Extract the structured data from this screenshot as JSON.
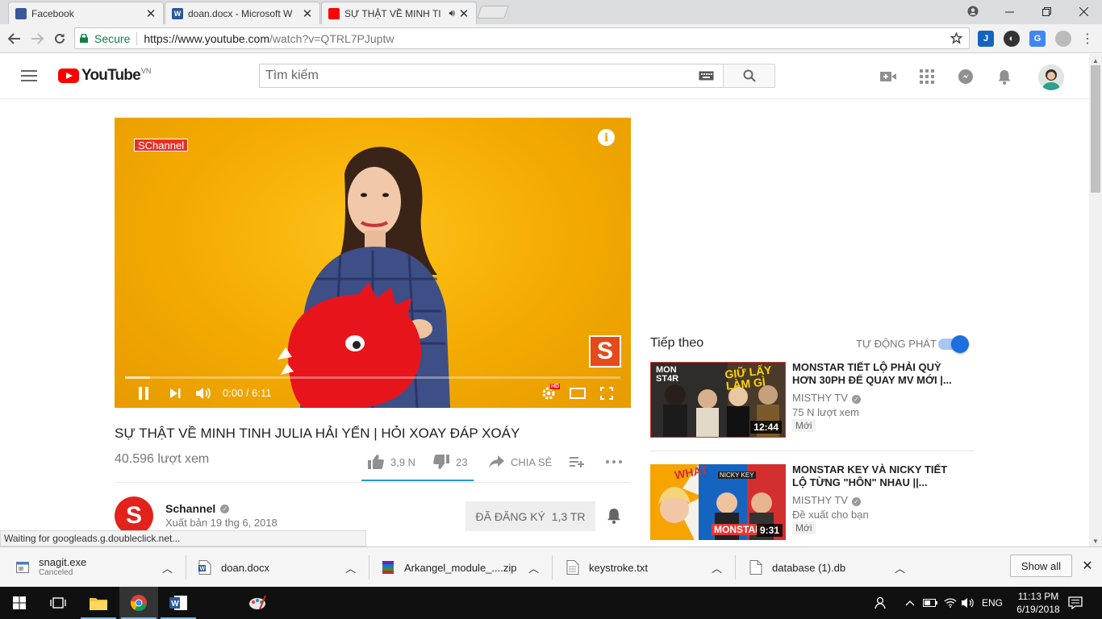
{
  "tabs": [
    {
      "title": "Facebook",
      "icon": "facebook-icon",
      "color": "#3b5998"
    },
    {
      "title": "doan.docx - Microsoft W",
      "icon": "word-icon",
      "color": "#2b579a"
    },
    {
      "title": "SỰ THẬT VỀ MINH TI",
      "icon": "youtube-icon",
      "color": "#ff0000",
      "audio": true
    }
  ],
  "address": {
    "secure_label": "Secure",
    "url_host": "https://www.youtube.com",
    "url_path": "/watch?v=QTRL7PJuptw"
  },
  "youtube": {
    "logo_text": "YouTube",
    "region": "VN",
    "search_placeholder": "Tìm kiếm"
  },
  "player": {
    "channel_watermark": "SChannel",
    "watermark_letter": "S",
    "time_current": "0:00",
    "time_total": "6:11",
    "time_display": "0:00 / 6:11",
    "progress_played": 0.0,
    "progress_buffered": 0.05,
    "hd_badge": "HD",
    "accent_color": "#ff0000"
  },
  "video": {
    "title": "SỰ THẬT VỀ MINH TINH JULIA HẢI YẾN | HỎI XOAY ĐÁP XOÁY",
    "views": "40.596 lượt xem",
    "likes": "3,9 N",
    "dislikes": "23",
    "share_label": "CHIA SẺ",
    "like_ratio": 0.994
  },
  "channel": {
    "name": "Schannel",
    "published": "Xuất bản 19 thg 6, 2018",
    "avatar_letter": "S",
    "subscribed_label": "ĐÃ ĐĂNG KÝ",
    "subscriber_count": "1,3 TR"
  },
  "sidebar": {
    "up_next_label": "Tiếp theo",
    "autoplay_label": "TỰ ĐỘNG PHÁT",
    "autoplay_on": true,
    "items": [
      {
        "title": "MONSTAR TIẾT LỘ PHẢI QUỲ HƠN 30PH ĐỂ QUAY MV MỚI |...",
        "channel": "MISTHY TV",
        "meta": "75 N lượt xem",
        "badge": "Mới",
        "duration": "12:44",
        "thumb_text_1": "MON ST4R",
        "thumb_text_2": "GIỮ LẤY LÀM GÌ"
      },
      {
        "title": "MONSTAR KEY VÀ NICKY TIẾT LỘ TỪNG \"HÔN\" NHAU ||...",
        "channel": "MISTHY TV",
        "meta": "Đề xuất cho bạn",
        "badge": "Mới",
        "duration": "9:31",
        "thumb_text_1": "WHAT",
        "thumb_text_2": "NICKY KEY",
        "thumb_text_3": "MONSTAR"
      }
    ]
  },
  "status_text": "Waiting for googleads.g.doubleclick.net...",
  "downloads": [
    {
      "name": "snagit.exe",
      "sub": "Canceled",
      "icon": "exe-file-icon"
    },
    {
      "name": "doan.docx",
      "sub": "",
      "icon": "word-file-icon"
    },
    {
      "name": "Arkangel_module_....zip",
      "sub": "",
      "icon": "archive-file-icon"
    },
    {
      "name": "keystroke.txt",
      "sub": "",
      "icon": "text-file-icon"
    },
    {
      "name": "database (1).db",
      "sub": "",
      "icon": "generic-file-icon"
    }
  ],
  "show_all_label": "Show all",
  "taskbar": {
    "language": "ENG",
    "time": "11:13 PM",
    "date": "6/19/2018"
  }
}
